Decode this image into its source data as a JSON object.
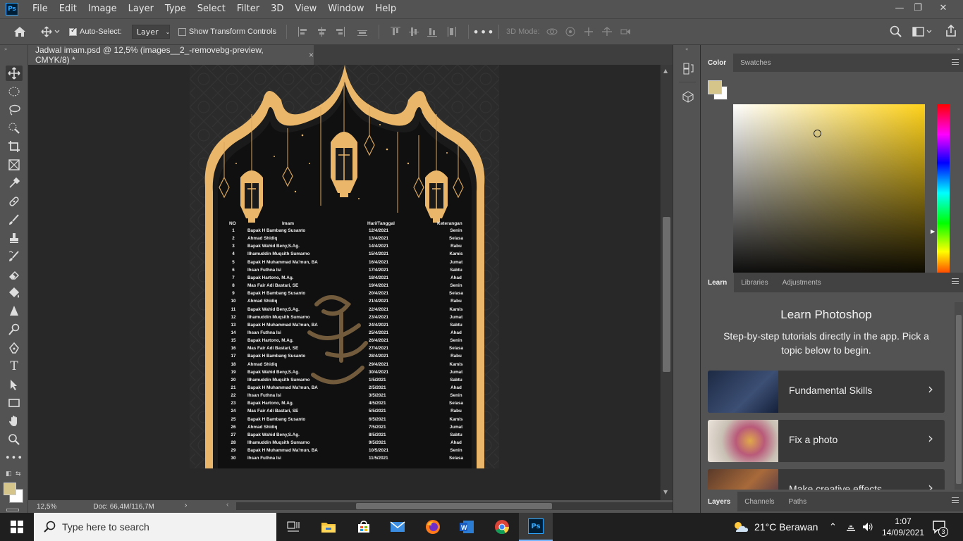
{
  "app": {
    "logo_text": "Ps"
  },
  "menu": [
    "File",
    "Edit",
    "Image",
    "Layer",
    "Type",
    "Select",
    "Filter",
    "3D",
    "View",
    "Window",
    "Help"
  ],
  "window_controls": {
    "minimize": "—",
    "restore": "❐",
    "close": "✕"
  },
  "options": {
    "auto_select_label": "Auto-Select:",
    "auto_select_checked": true,
    "layer_select": "Layer",
    "transform_label": "Show Transform Controls",
    "transform_checked": false,
    "mode_3d_label": "3D Mode:"
  },
  "document": {
    "tab_title": "Jadwal imam.psd @ 12,5% (images__2_-removebg-preview, CMYK/8) *",
    "close_glyph": "×"
  },
  "schedule": {
    "headers": {
      "no": "NO",
      "imam": "Imam",
      "date": "Hari/Tanggal",
      "note": "Keterangan"
    },
    "rows": [
      {
        "no": "1",
        "imam": "Bapak H Bambang Susanto",
        "date": "12/4/2021",
        "note": "Senin"
      },
      {
        "no": "2",
        "imam": "Ahmad Shidiq",
        "date": "13/4/2021",
        "note": "Selasa"
      },
      {
        "no": "3",
        "imam": "Bapak Wahid Beny,S.Ag.",
        "date": "14/4/2021",
        "note": "Rabu"
      },
      {
        "no": "4",
        "imam": "Ilhamuddin Muqsith Sumarno",
        "date": "15/4/2021",
        "note": "Kamis"
      },
      {
        "no": "5",
        "imam": "Bapak H Muhammad Ma'mun, BA",
        "date": "16/4/2021",
        "note": "Jumat"
      },
      {
        "no": "6",
        "imam": "Ihsan Futhna Isi",
        "date": "17/4/2021",
        "note": "Sabtu"
      },
      {
        "no": "7",
        "imam": "Bapak Hartono, M.Ag.",
        "date": "18/4/2021",
        "note": "Ahad"
      },
      {
        "no": "8",
        "imam": "Mas Fair Adi Bastari, SE",
        "date": "19/4/2021",
        "note": "Senin"
      },
      {
        "no": "9",
        "imam": "Bapak H Bambang Susanto",
        "date": "20/4/2021",
        "note": "Selasa"
      },
      {
        "no": "10",
        "imam": "Ahmad Shidiq",
        "date": "21/4/2021",
        "note": "Rabu"
      },
      {
        "no": "11",
        "imam": "Bapak Wahid Beny,S.Ag.",
        "date": "22/4/2021",
        "note": "Kamis"
      },
      {
        "no": "12",
        "imam": "Ilhamuddin Muqsith Sumarno",
        "date": "23/4/2021",
        "note": "Jumat"
      },
      {
        "no": "13",
        "imam": "Bapak H Muhammad Ma'mun, BA",
        "date": "24/4/2021",
        "note": "Sabtu"
      },
      {
        "no": "14",
        "imam": "Ihsan Futhna Isi",
        "date": "25/4/2021",
        "note": "Ahad"
      },
      {
        "no": "15",
        "imam": "Bapak Hartono, M.Ag.",
        "date": "26/4/2021",
        "note": "Senin"
      },
      {
        "no": "16",
        "imam": "Mas Fair Adi Bastari, SE",
        "date": "27/4/2021",
        "note": "Selasa"
      },
      {
        "no": "17",
        "imam": "Bapak H Bambang Susanto",
        "date": "28/4/2021",
        "note": "Rabu"
      },
      {
        "no": "18",
        "imam": "Ahmad Shidiq",
        "date": "29/4/2021",
        "note": "Kamis"
      },
      {
        "no": "19",
        "imam": "Bapak Wahid Beny,S.Ag.",
        "date": "30/4/2021",
        "note": "Jumat"
      },
      {
        "no": "20",
        "imam": "Ilhamuddin Muqsith Sumarno",
        "date": "1/5/2021",
        "note": "Sabtu"
      },
      {
        "no": "21",
        "imam": "Bapak H Muhammad Ma'mun, BA",
        "date": "2/5/2021",
        "note": "Ahad"
      },
      {
        "no": "22",
        "imam": "Ihsan Futhna Isi",
        "date": "3/5/2021",
        "note": "Senin"
      },
      {
        "no": "23",
        "imam": "Bapak Hartono, M.Ag.",
        "date": "4/5/2021",
        "note": "Selasa"
      },
      {
        "no": "24",
        "imam": "Mas Fair Adi Bastari, SE",
        "date": "5/5/2021",
        "note": "Rabu"
      },
      {
        "no": "25",
        "imam": "Bapak H Bambang Susanto",
        "date": "6/5/2021",
        "note": "Kamis"
      },
      {
        "no": "26",
        "imam": "Ahmad Shidiq",
        "date": "7/5/2021",
        "note": "Jumat"
      },
      {
        "no": "27",
        "imam": "Bapak Wahid Beny,S.Ag.",
        "date": "8/5/2021",
        "note": "Sabtu"
      },
      {
        "no": "28",
        "imam": "Ilhamuddin Muqsith Sumarno",
        "date": "9/5/2021",
        "note": "Ahad"
      },
      {
        "no": "29",
        "imam": "Bapak H Muhammad Ma'mun, BA",
        "date": "10/5/2021",
        "note": "Senin"
      },
      {
        "no": "30",
        "imam": "Ihsan Futhna Isi",
        "date": "11/5/2021",
        "note": "Selasa"
      }
    ]
  },
  "status": {
    "zoom": "12,5%",
    "doc": "Doc: 66,4M/116,7M"
  },
  "colors": {
    "foreground": "#d5c58b",
    "background": "#ffffff",
    "gold": "#e9b66a",
    "accent": "#31a8ff"
  },
  "color_panel": {
    "tabs": [
      "Color",
      "Swatches"
    ]
  },
  "learn_panel": {
    "tabs": [
      "Learn",
      "Libraries",
      "Adjustments"
    ],
    "title": "Learn Photoshop",
    "subtitle": "Step-by-step tutorials directly in the app. Pick a topic below to begin.",
    "cards": [
      "Fundamental Skills",
      "Fix a photo",
      "Make creative effects"
    ]
  },
  "layers_panel": {
    "tabs": [
      "Layers",
      "Channels",
      "Paths"
    ]
  },
  "taskbar": {
    "search_placeholder": "Type here to search",
    "weather": "21°C  Berawan",
    "time": "1:07",
    "date": "14/09/2021",
    "notifications": "3"
  }
}
